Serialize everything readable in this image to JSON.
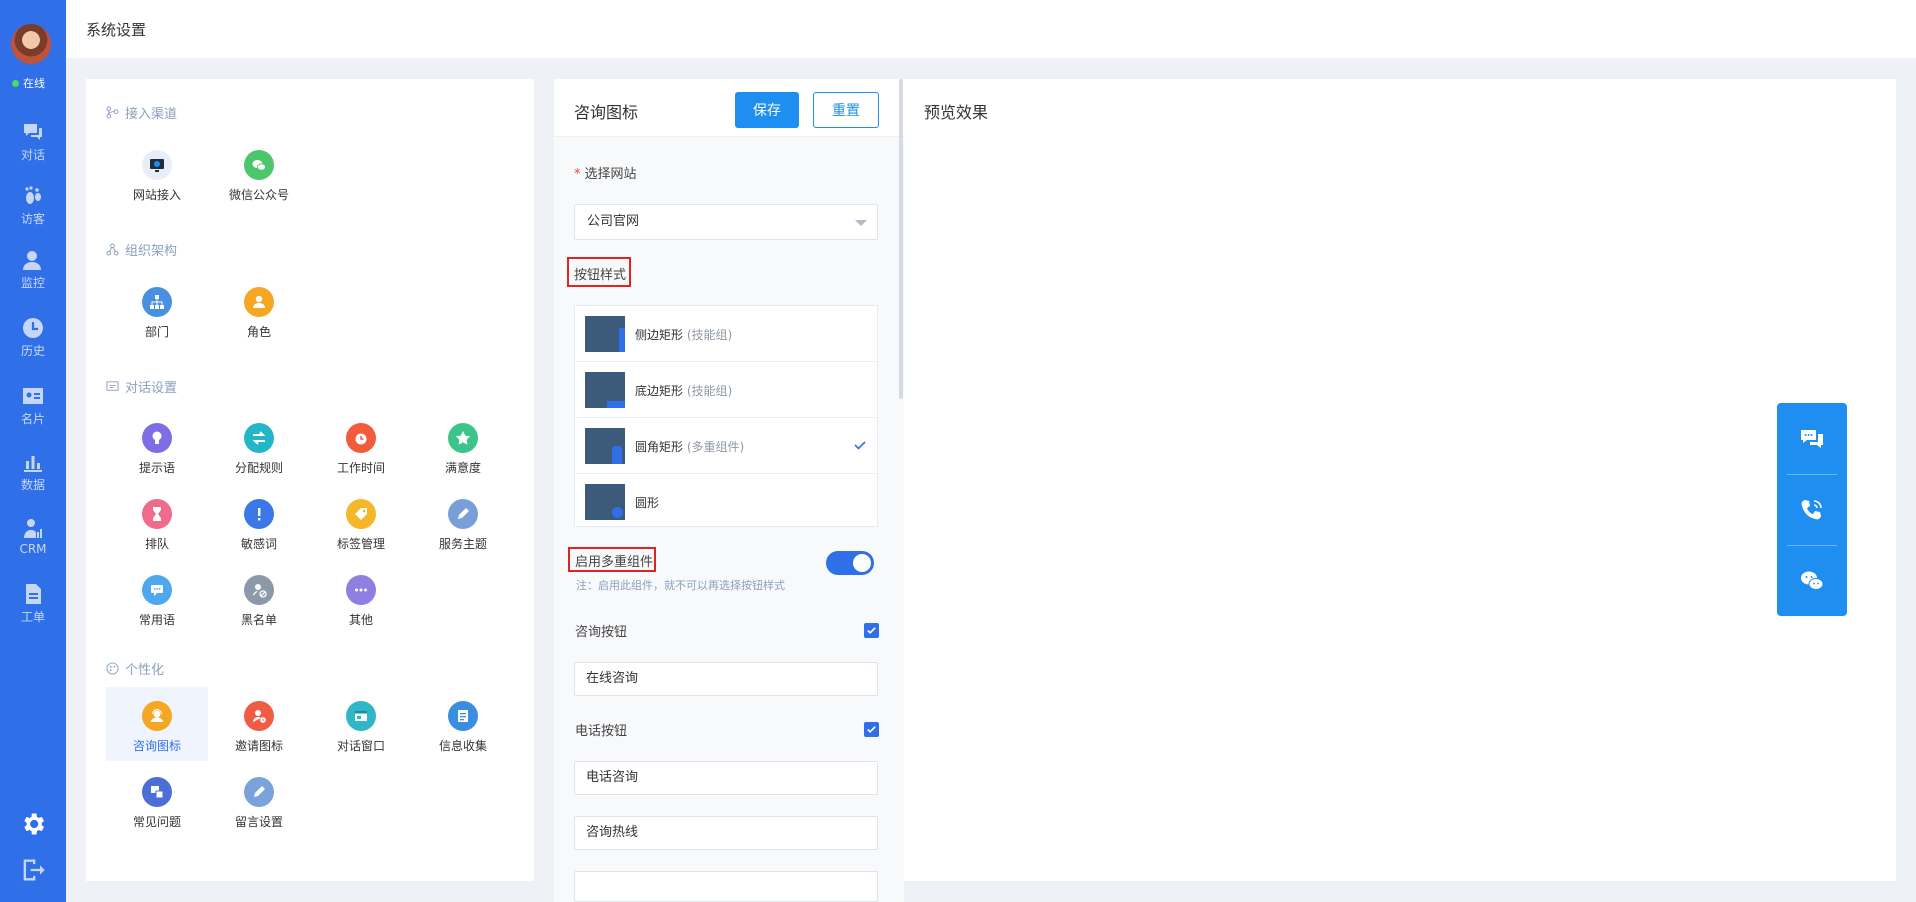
{
  "header": {
    "title": "系统设置"
  },
  "user": {
    "status": "在线"
  },
  "nav": [
    {
      "key": "chat",
      "label": "对话",
      "icon": "chat-icon"
    },
    {
      "key": "visitor",
      "label": "访客",
      "icon": "footprint-icon"
    },
    {
      "key": "monitor",
      "label": "监控",
      "icon": "monitor-icon"
    },
    {
      "key": "history",
      "label": "历史",
      "icon": "clock-icon"
    },
    {
      "key": "card",
      "label": "名片",
      "icon": "id-card-icon"
    },
    {
      "key": "data",
      "label": "数据",
      "icon": "bar-chart-icon"
    },
    {
      "key": "crm",
      "label": "CRM",
      "icon": "crm-icon"
    },
    {
      "key": "ticket",
      "label": "工单",
      "icon": "document-icon"
    }
  ],
  "left": {
    "sections": [
      {
        "title": "接入渠道",
        "items": [
          "网站接入",
          "微信公众号"
        ]
      },
      {
        "title": "组织架构",
        "items": [
          "部门",
          "角色"
        ]
      },
      {
        "title": "对话设置",
        "items": [
          "提示语",
          "分配规则",
          "工作时间",
          "满意度",
          "排队",
          "敏感词",
          "标签管理",
          "服务主题",
          "常用语",
          "黑名单",
          "其他"
        ]
      },
      {
        "title": "个性化",
        "items": [
          "咨询图标",
          "邀请图标",
          "对话窗口",
          "信息收集",
          "常见问题",
          "留言设置"
        ]
      }
    ]
  },
  "mid": {
    "title": "咨询图标",
    "save": "保存",
    "reset": "重置",
    "site_label": "选择网站",
    "site_required": "*",
    "site_value": "公司官网",
    "style_label": "按钮样式",
    "styles": [
      {
        "name": "侧边矩形",
        "sub": "(技能组)"
      },
      {
        "name": "底边矩形",
        "sub": "(技能组)"
      },
      {
        "name": "圆角矩形",
        "sub": "(多重组件)"
      },
      {
        "name": "圆形",
        "sub": ""
      }
    ],
    "multi_label": "启用多重组件",
    "multi_enabled": true,
    "multi_note": "注：启用此组件，就不可以再选择按钮样式",
    "consult_label": "咨询按钮",
    "consult_checked": true,
    "consult_value": "在线咨询",
    "phone_label": "电话按钮",
    "phone_checked": true,
    "phone_value": "电话咨询",
    "hotline_value": "咨询热线"
  },
  "preview": {
    "title": "预览效果"
  },
  "colors": {
    "nav": "#2f6fe7",
    "accent": "#1f8ef1",
    "highlight": "#e02424"
  }
}
